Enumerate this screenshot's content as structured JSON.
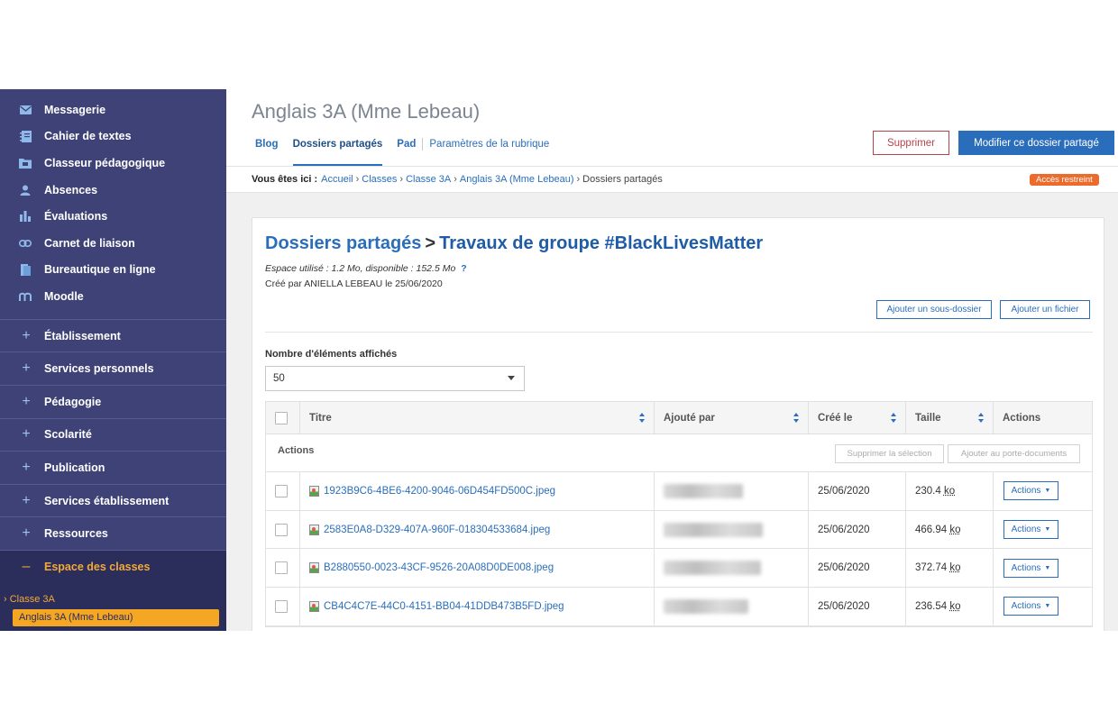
{
  "sidebar": {
    "items": [
      {
        "label": "Messagerie",
        "icon": "mail-icon"
      },
      {
        "label": "Cahier de textes",
        "icon": "notebook-icon"
      },
      {
        "label": "Classeur pédagogique",
        "icon": "folder-icon"
      },
      {
        "label": "Absences",
        "icon": "user-icon"
      },
      {
        "label": "Évaluations",
        "icon": "bar-chart-icon"
      },
      {
        "label": "Carnet de liaison",
        "icon": "link-icon"
      },
      {
        "label": "Bureautique en ligne",
        "icon": "document-icon"
      },
      {
        "label": "Moodle",
        "icon": "moodle-icon"
      }
    ],
    "sections": [
      {
        "label": "Établissement",
        "symbol": "+"
      },
      {
        "label": "Services personnels",
        "symbol": "+"
      },
      {
        "label": "Pédagogie",
        "symbol": "+"
      },
      {
        "label": "Scolarité",
        "symbol": "+"
      },
      {
        "label": "Publication",
        "symbol": "+"
      },
      {
        "label": "Services établissement",
        "symbol": "+"
      },
      {
        "label": "Ressources",
        "symbol": "+"
      },
      {
        "label": "Espace des classes",
        "symbol": "–"
      }
    ],
    "class_group": "› Classe 3A",
    "class_current": "Anglais 3A (Mme Lebeau)"
  },
  "header": {
    "title": "Anglais 3A (Mme Lebeau)",
    "tabs": [
      "Blog",
      "Dossiers partagés",
      "Pad",
      "Paramètres de la rubrique"
    ],
    "delete_label": "Supprimer",
    "modify_label": "Modifier ce dossier partagé"
  },
  "breadcrumb": {
    "prefix": "Vous êtes ici :",
    "links": [
      "Accueil",
      "Classes",
      "Classe 3A",
      "Anglais 3A (Mme Lebeau)"
    ],
    "current": "Dossiers partagés",
    "badge": "Accès restreint"
  },
  "folder": {
    "parent": "Dossiers partagés",
    "separator": ">",
    "name": "Travaux de groupe #BlackLivesMatter",
    "space": "Espace utilisé : 1.2 Mo, disponible : 152.5 Mo",
    "help": "?",
    "created": "Créé par ANIELLA LEBEAU le 25/06/2020",
    "add_subfolder": "Ajouter un sous-dossier",
    "add_file": "Ajouter un fichier"
  },
  "listing": {
    "count_label": "Nombre d'éléments affichés",
    "count_value": "50",
    "columns": [
      "Titre",
      "Ajouté par",
      "Créé le",
      "Taille",
      "Actions"
    ],
    "actions_label": "Actions",
    "delete_selection": "Supprimer la sélection",
    "add_to_portfolio": "Ajouter au porte-documents",
    "rows": [
      {
        "title": "1923B9C6-4BE6-4200-9046-06D454FD500C.jpeg",
        "date": "25/06/2020",
        "size": "230.4",
        "unit": "ko",
        "action": "Actions"
      },
      {
        "title": "2583E0A8-D329-407A-960F-018304533684.jpeg",
        "date": "25/06/2020",
        "size": "466.94",
        "unit": "ko",
        "action": "Actions"
      },
      {
        "title": "B2880550-0023-43CF-9526-20A08D0DE008.jpeg",
        "date": "25/06/2020",
        "size": "372.74",
        "unit": "ko",
        "action": "Actions"
      },
      {
        "title": "CB4C4C7E-44C0-4151-BB04-41DDB473B5FD.jpeg",
        "date": "25/06/2020",
        "size": "236.54",
        "unit": "ko",
        "action": "Actions"
      }
    ]
  },
  "colors": {
    "sidebar": "#3f4276",
    "accent": "#2a6ebb",
    "active": "#f5a623",
    "danger": "#b5434b",
    "badge": "#ec6a2b"
  }
}
